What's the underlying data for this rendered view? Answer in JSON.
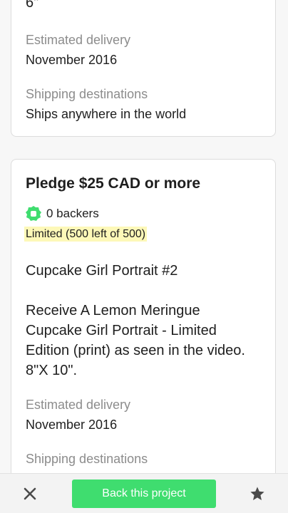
{
  "top_card": {
    "partial_text": "6\"",
    "delivery_label": "Estimated delivery",
    "delivery_value": "November 2016",
    "shipping_label": "Shipping destinations",
    "shipping_value": "Ships anywhere in the world"
  },
  "reward": {
    "pledge_title": "Pledge $25 CAD or more",
    "backers": "0 backers",
    "limited": "Limited (500 left of 500)",
    "title": "Cupcake Girl Portrait #2",
    "description": "Receive A Lemon Meringue Cupcake Girl Portrait -  Limited Edition (print) as seen in the video.  8\"X 10\".",
    "delivery_label": "Estimated delivery",
    "delivery_value": "November 2016",
    "shipping_label": "Shipping destinations"
  },
  "bottom_bar": {
    "close_icon": "close-icon",
    "back_label": "Back this project",
    "star_icon": "star-icon",
    "accent_color": "#3fdd6f"
  }
}
